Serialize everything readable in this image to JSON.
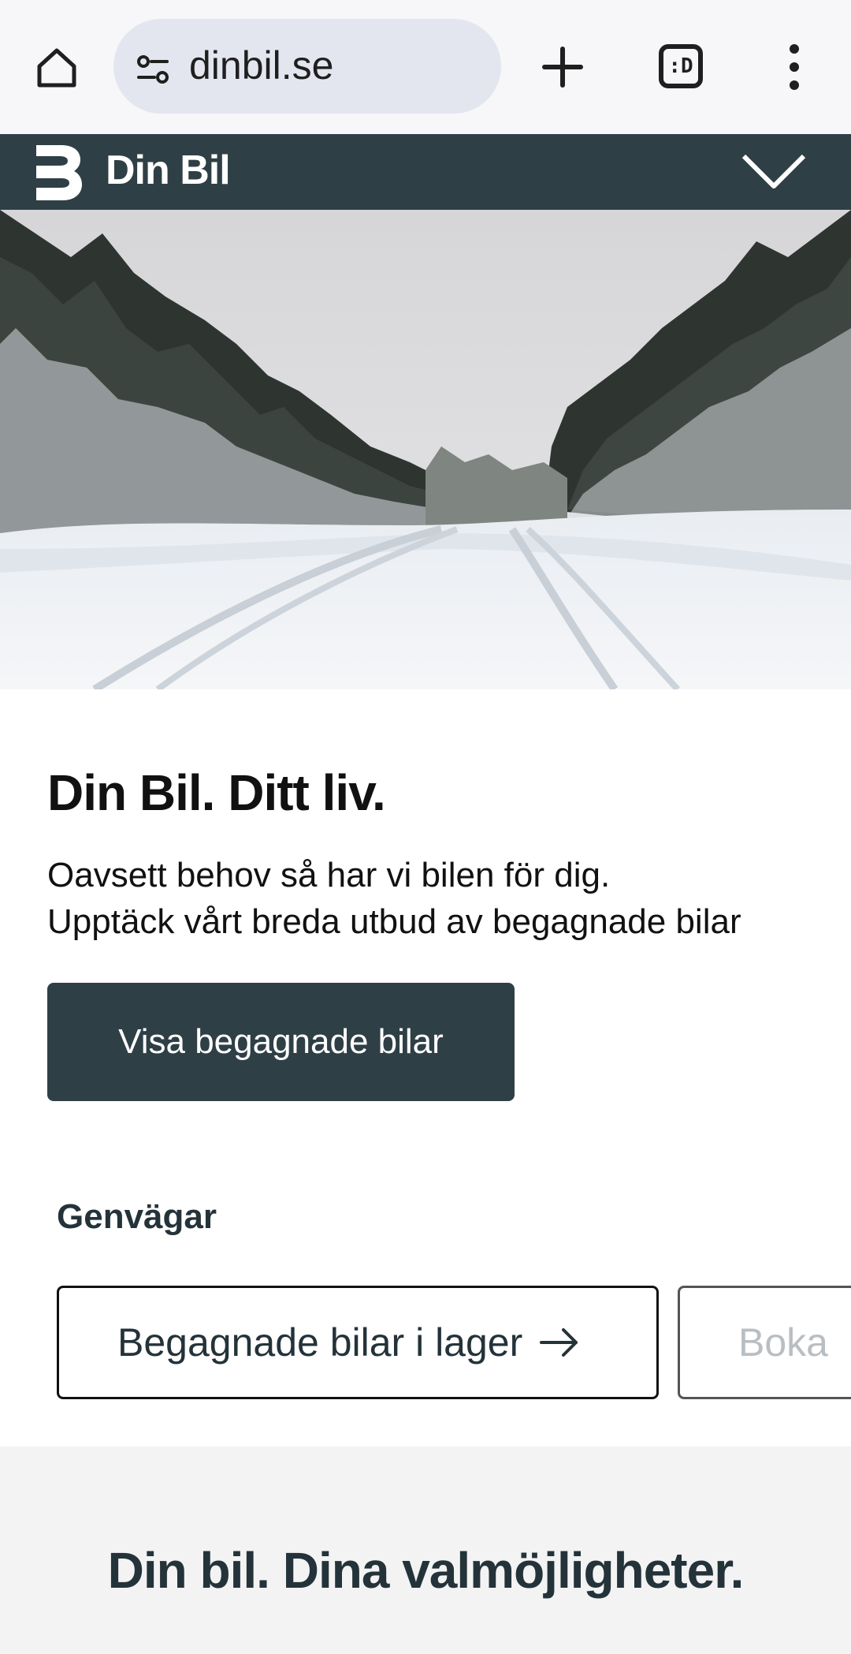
{
  "browser": {
    "url": "dinbil.se",
    "tab_switcher_label": ":D"
  },
  "header": {
    "brand": "Din Bil"
  },
  "hero": {
    "alt": "Snowy forest road"
  },
  "intro": {
    "title": "Din Bil. Ditt liv.",
    "line1": "Oavsett behov så har vi bilen för dig.",
    "line2": "Upptäck vårt breda utbud av begagnade bilar",
    "cta_label": "Visa begagnade bilar"
  },
  "shortcuts": {
    "title": "Genvägar",
    "items": [
      {
        "label": "Begagnade bilar i lager"
      },
      {
        "label": "Boka"
      }
    ]
  },
  "section2": {
    "title": "Din bil. Dina valmöjligheter."
  },
  "colors": {
    "brand_dark": "#2f3f46",
    "chrome_bg": "#f7f7fa",
    "urlbar_bg": "#e3e6ef",
    "section_bg": "#f3f3f4"
  }
}
